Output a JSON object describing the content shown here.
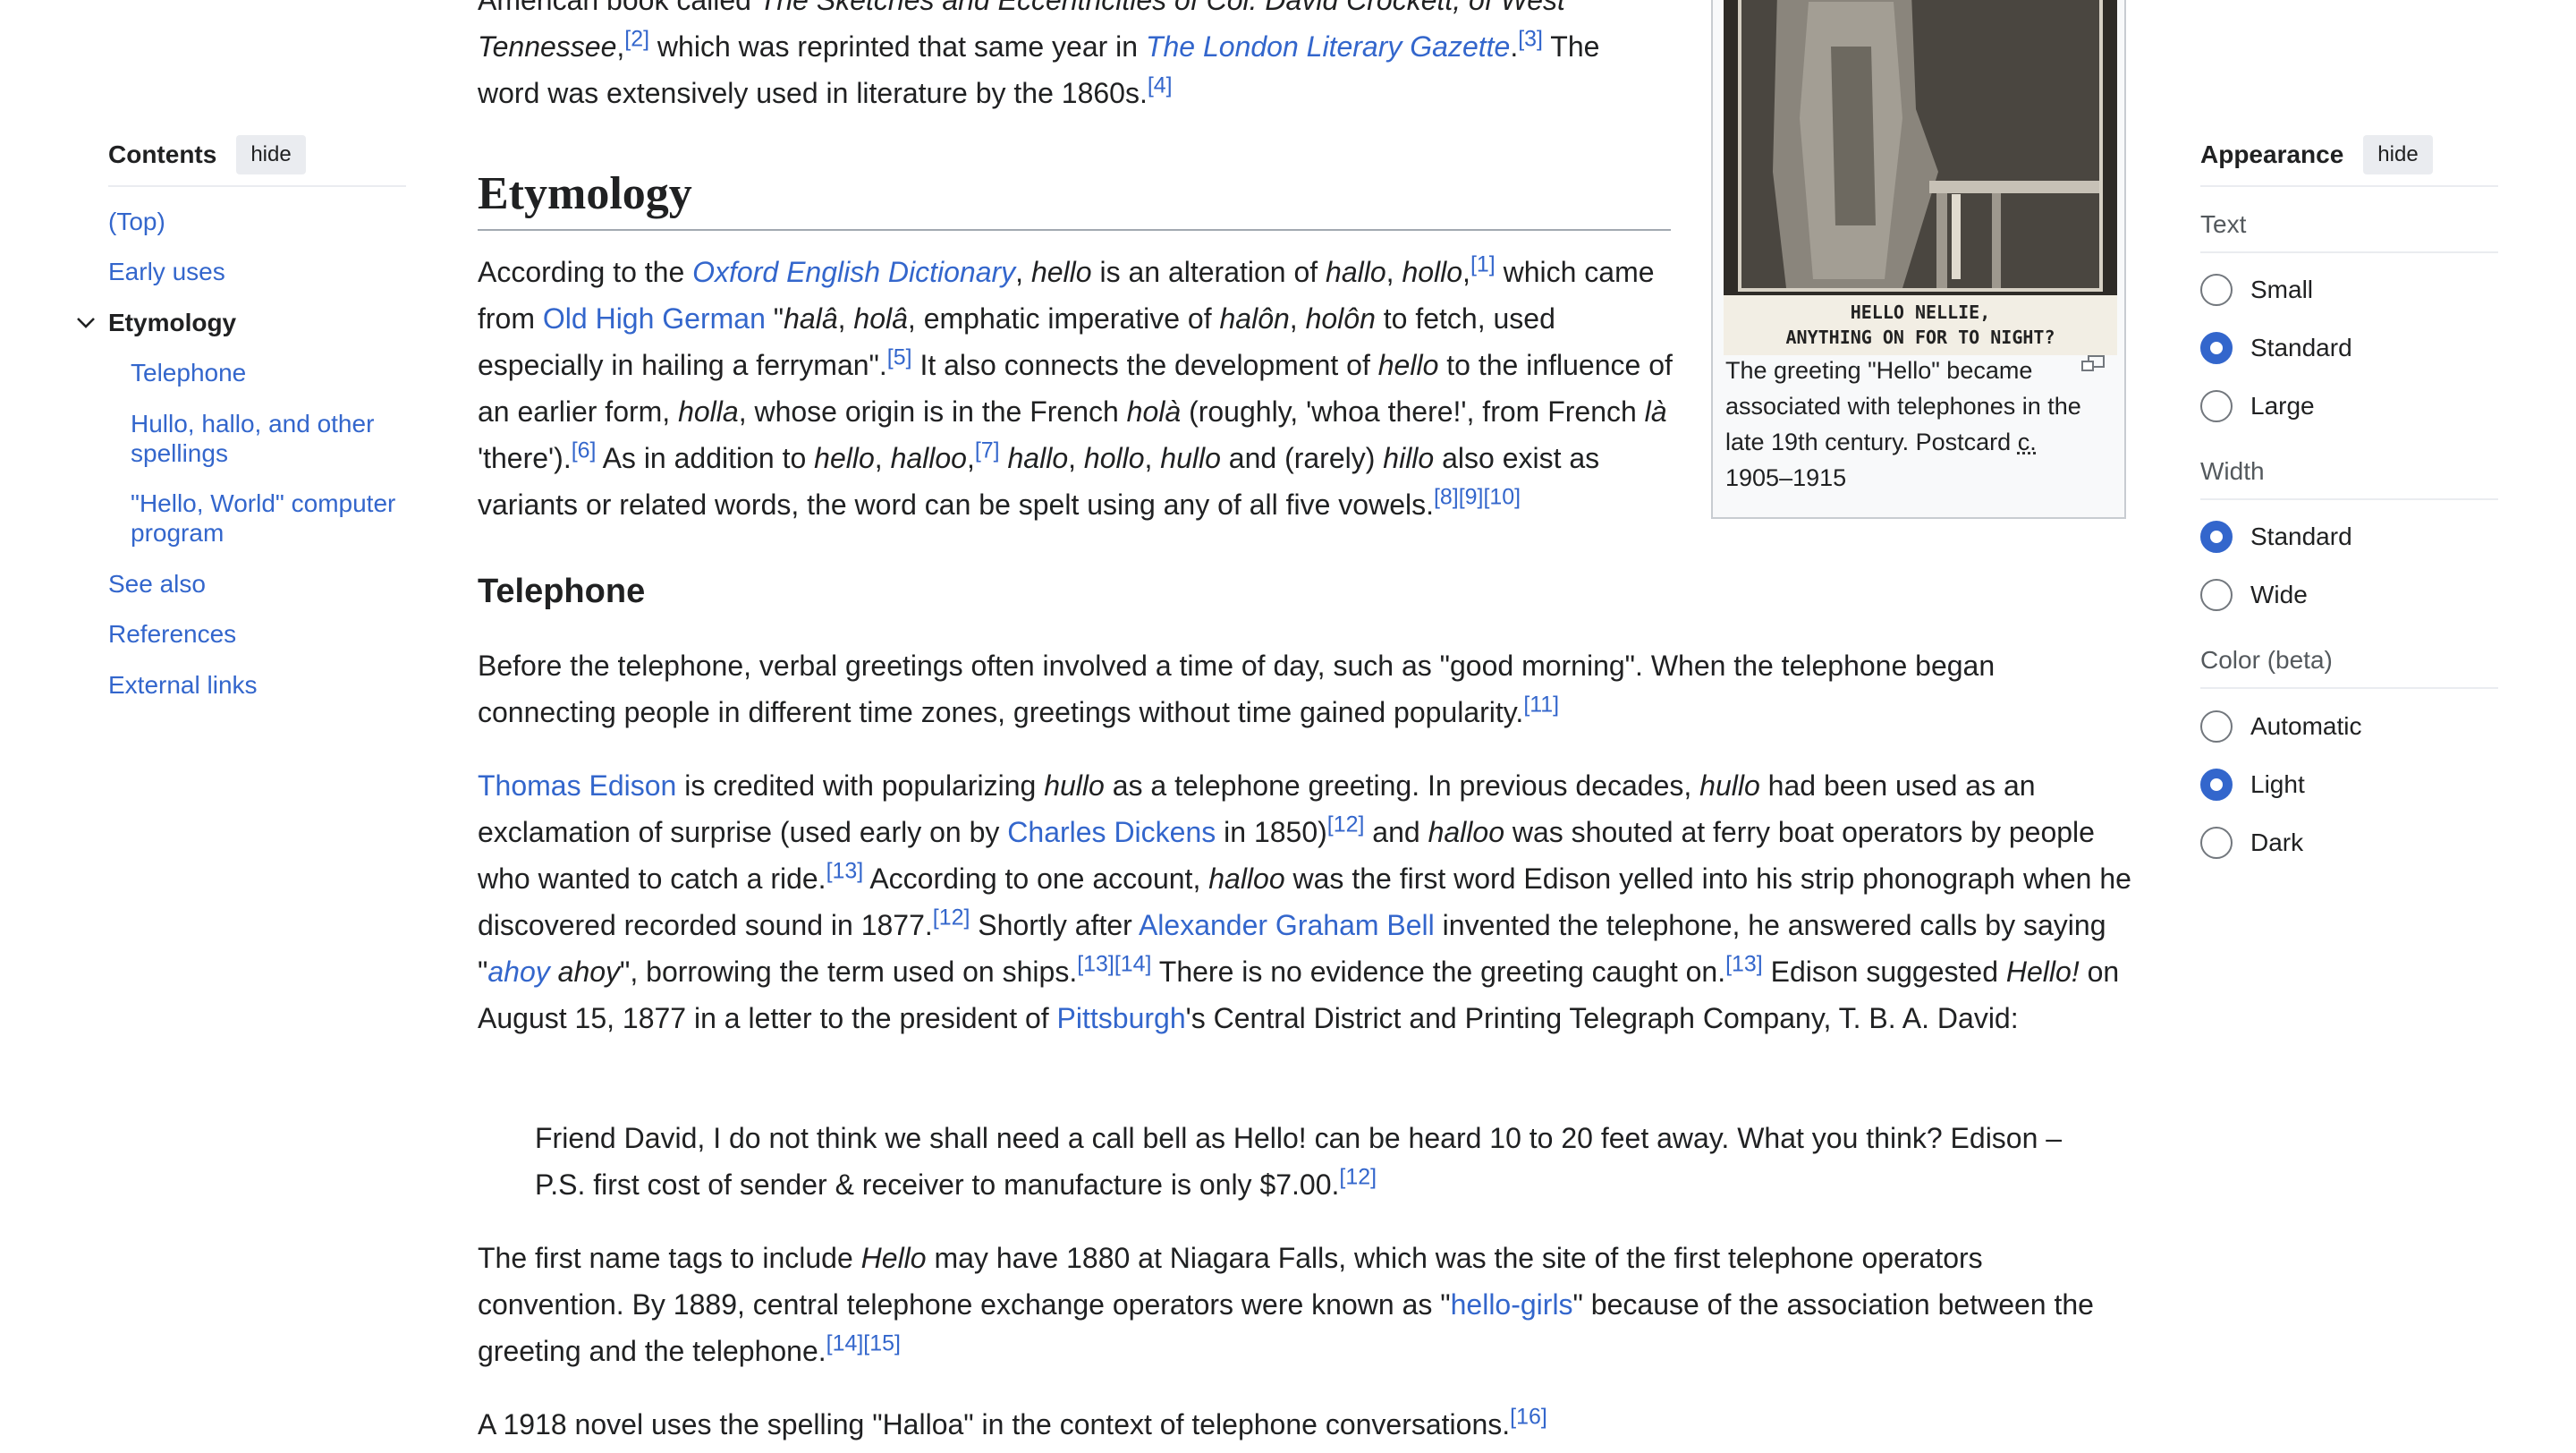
{
  "toc": {
    "title": "Contents",
    "hide_label": "hide",
    "items": [
      {
        "label": "(Top)"
      },
      {
        "label": "Early uses"
      },
      {
        "label": "Etymology"
      },
      {
        "label": "Telephone"
      },
      {
        "label": "Hullo, hallo, and other spellings"
      },
      {
        "label": "\"Hello, World\" computer program"
      },
      {
        "label": "See also"
      },
      {
        "label": "References"
      },
      {
        "label": "External links"
      }
    ]
  },
  "appearance": {
    "title": "Appearance",
    "hide_label": "hide",
    "text": {
      "label": "Text",
      "options": [
        "Small",
        "Standard",
        "Large"
      ],
      "selected": "Standard"
    },
    "width": {
      "label": "Width",
      "options": [
        "Standard",
        "Wide"
      ],
      "selected": "Standard"
    },
    "color": {
      "label": "Color (beta)",
      "options": [
        "Automatic",
        "Light",
        "Dark"
      ],
      "selected": "Light"
    }
  },
  "infobox": {
    "postcard_text": [
      "HELLO NELLIE,",
      "ANYTHING ON FOR TO NIGHT?"
    ],
    "caption": "The greeting \"Hello\" became associated with telephones in the late 19th century. Postcard",
    "caption_abbr": "c.",
    "caption_years": "1905–1915"
  },
  "intro": {
    "line1_pre": "American book called ",
    "line1_title": "The Sketches and Eccentricities of Col. David Crockett, of West",
    "line2_title": "Tennessee",
    "line2_ref": "[2]",
    "line2_mid": " which was reprinted that same year in ",
    "line2_link": "The London Literary Gazette",
    "line2_ref2": "[3]",
    "line2_end": " The",
    "line3": "word was extensively used in literature by the 1860s.",
    "line3_ref": "[4]"
  },
  "etymology": {
    "heading": "Etymology",
    "p1": {
      "t1": "According to the ",
      "l1": "Oxford English Dictionary",
      "t2": ", ",
      "e1": "hello",
      "t3": " is an alteration of ",
      "e2": "hallo",
      "t4": ", ",
      "e3": "hollo",
      "t5": ",",
      "r1": "[1]",
      "t6": " which came from ",
      "l2": "Old High German",
      "t7": " \"",
      "e4": "halâ",
      "t8": ", ",
      "e5": "holâ",
      "t9": ", emphatic imperative of ",
      "e6": "halôn",
      "t10": ", ",
      "e7": "holôn",
      "t11": " to fetch, used especially in hailing a ferryman\".",
      "r2": "[5]",
      "t12": " It also connects the development of ",
      "e8": "hello",
      "t13": " to the influence of an earlier form, ",
      "e9": "holla",
      "t14": ", whose origin is in the French ",
      "e10": "holà",
      "t15": " (roughly, 'whoa there!', from French ",
      "e11": "là",
      "t16": " 'there').",
      "r3": "[6]",
      "t17": " As in addition to ",
      "e12": "hello",
      "t18": ", ",
      "e13": "halloo",
      "t19": ",",
      "r4": "[7]",
      "t20": " ",
      "e14": "hallo",
      "t21": ", ",
      "e15": "hollo",
      "t22": ", ",
      "e16": "hullo",
      "t23": " and (rarely) ",
      "e17": "hillo",
      "t24": " also exist as variants or related words, the word can be spelt using any of all five vowels.",
      "r5": "[8][9][10]"
    }
  },
  "telephone": {
    "heading": "Telephone",
    "p1": {
      "t1": "Before the telephone, verbal greetings often involved a time of day, such as \"good morning\". When the telephone began connecting people in different time zones, greetings without time gained popularity.",
      "r1": "[11]"
    },
    "p2": {
      "l1": "Thomas Edison",
      "t1": " is credited with popularizing ",
      "e1": "hullo",
      "t2": " as a telephone greeting. In previous decades, ",
      "e2": "hullo",
      "t3": " had been used as an exclamation of surprise (used early on by ",
      "l2": "Charles Dickens",
      "t4": " in 1850)",
      "r1": "[12]",
      "t5": " and ",
      "e3": "halloo",
      "t6": " was shouted at ferry boat operators by people who wanted to catch a ride.",
      "r2": "[13]",
      "t7": " According to one account, ",
      "e4": "halloo",
      "t8": " was the first word Edison yelled into his strip phonograph when he discovered recorded sound in 1877.",
      "r3": "[12]",
      "t9": " Shortly after ",
      "l3": "Alexander Graham Bell",
      "t10": " invented the telephone, he answered calls by saying \"",
      "l4": "ahoy",
      "t11": " ",
      "e5": "ahoy",
      "t12": "\", borrowing the term used on ships.",
      "r4": "[13][14]",
      "t13": " There is no evidence the greeting caught on.",
      "r5": "[13]",
      "t14": " Edison suggested ",
      "e6": "Hello!",
      "t15": " on August 15, 1877 in a letter to the president of ",
      "l5": "Pittsburgh",
      "t16": "'s Central District and Printing Telegraph Company, T. B. A. David:"
    },
    "quote": {
      "t1": "Friend David, I do not think we shall need a call bell as Hello! can be heard 10 to 20 feet away. What you think? Edison – P.S. first cost of sender & receiver to manufacture is only $7.00.",
      "r1": "[12]"
    },
    "p3": {
      "t1": "The first name tags to include ",
      "e1": "Hello",
      "t2": " may have 1880 at Niagara Falls, which was the site of the first telephone operators convention. By 1889, central telephone exchange operators were known as \"",
      "l1": "hello-girls",
      "t3": "\" because of the association between the greeting and the telephone.",
      "r1": "[14][15]"
    },
    "p4": {
      "t1": "A 1918 novel uses the spelling \"Halloa\" in the context of telephone conversations.",
      "r1": "[16]"
    }
  }
}
